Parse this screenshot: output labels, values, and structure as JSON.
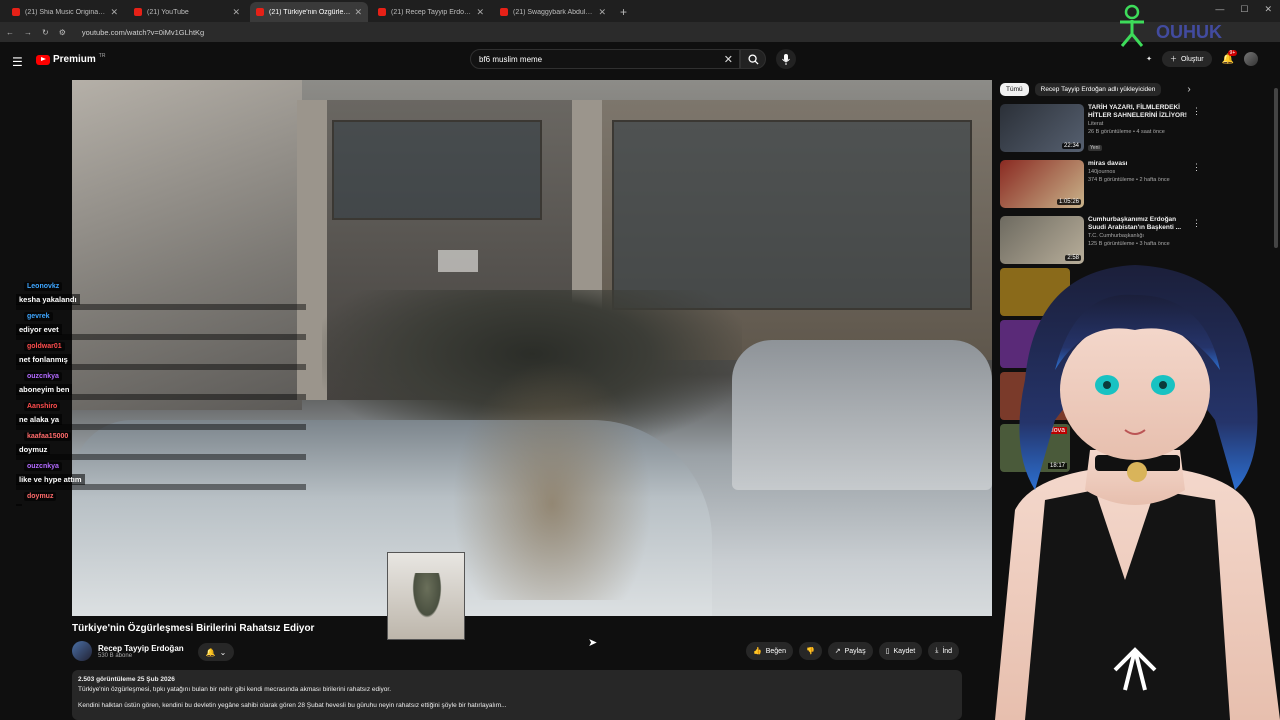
{
  "browser": {
    "tabs": [
      {
        "title": "(21) Shia Music Original Ali Ali",
        "active": false
      },
      {
        "title": "(21) YouTube",
        "active": false
      },
      {
        "title": "(21) Türkiye'nin Özgürleşme",
        "active": true
      },
      {
        "title": "(21) Recep Tayyip Erdoğan - Yo",
        "active": false
      },
      {
        "title": "(21) Swaggybark Abdulkadir Gü",
        "active": false
      }
    ],
    "url": "youtube.com/watch?v=0iMv1GLhtKg"
  },
  "header": {
    "brand": "Premium",
    "brand_region": "TR",
    "search_value": "bf6 muslim meme",
    "create_label": "Oluştur",
    "notif_badge": "9+"
  },
  "chat": [
    {
      "name": "Leonovkz",
      "message": "kesha yakalandı",
      "color": "#3ea6ff"
    },
    {
      "name": "gevrek",
      "message": "ediyor evet",
      "color": "#3ea6ff"
    },
    {
      "name": "goldwar01",
      "message": "net fonlanmış",
      "color": "#ff4d4d"
    },
    {
      "name": "ouzcnkya",
      "message": "aboneyim ben",
      "color": "#b36bff"
    },
    {
      "name": "Aanshiro",
      "message": "ne alaka ya",
      "color": "#ff4d4d"
    },
    {
      "name": "kaafaa15000",
      "message": "doymuz",
      "color": "#ff6b6b"
    },
    {
      "name": "ouzcnkya",
      "message": "like ve hype attım",
      "color": "#b36bff"
    },
    {
      "name": "doymuz",
      "message": "",
      "color": "#ff6b6b"
    }
  ],
  "video": {
    "title": "Türkiye'nin Özgürleşmesi Birilerini Rahatsız Ediyor",
    "channel": "Recep Tayyip Erdoğan",
    "subscribers": "530 B abone",
    "actions": {
      "like": "Beğen",
      "share": "Paylaş",
      "save": "Kaydet",
      "download": "İnd"
    },
    "views_date": "2.503 görüntüleme  25 Şub 2026",
    "desc_line1": "Türkiye'nin özgürleşmesi, tıpkı yatağını bulan bir nehir gibi kendi mecrasında akması birilerini rahatsız ediyor.",
    "desc_line2": "Kendini halktan üstün gören, kendini bu devletin yegâne sahibi olarak gören 28 Şubat hevesli bu güruhu neyin rahatsız ettiğini şöyle bir hatırlayalım..."
  },
  "sidebar": {
    "chips": [
      "Tümü",
      "Recep Tayyip Erdoğan adlı yükleyiciden"
    ],
    "recommendations": [
      {
        "title": "TARİH YAZARI, FİLMLERDEKİ HİTLER SAHNELERİNİ İZLİYOR!",
        "channel": "Literat",
        "meta": "26 B görüntüleme • 4 saat önce",
        "badge": "Yeni",
        "duration": "22:34",
        "thumb": "#3a4048"
      },
      {
        "title": "miras davası",
        "channel": "140journos",
        "meta": "374 B görüntüleme • 2 hafta önce",
        "badge": "",
        "duration": "1:05:26",
        "thumb": "#7a2a24"
      },
      {
        "title": "Cumhurbaşkanımız Erdoğan Suudi Arabistan'ın Başkenti ...",
        "channel": "T.C. Cumhurbaşkanlığı",
        "meta": "125 B görüntüleme • 3 hafta önce",
        "badge": "",
        "duration": "2:58",
        "thumb": "#6d6a60"
      }
    ],
    "partial_thumbs": [
      "#8a6a1a",
      "#5a2a78",
      "#7a3a2a",
      "#4a5a3a"
    ],
    "partial_label": "Yalova",
    "partial_duration": "18:17"
  },
  "colors": {
    "accent": "#ff0000",
    "bg": "#0f0f0f"
  }
}
